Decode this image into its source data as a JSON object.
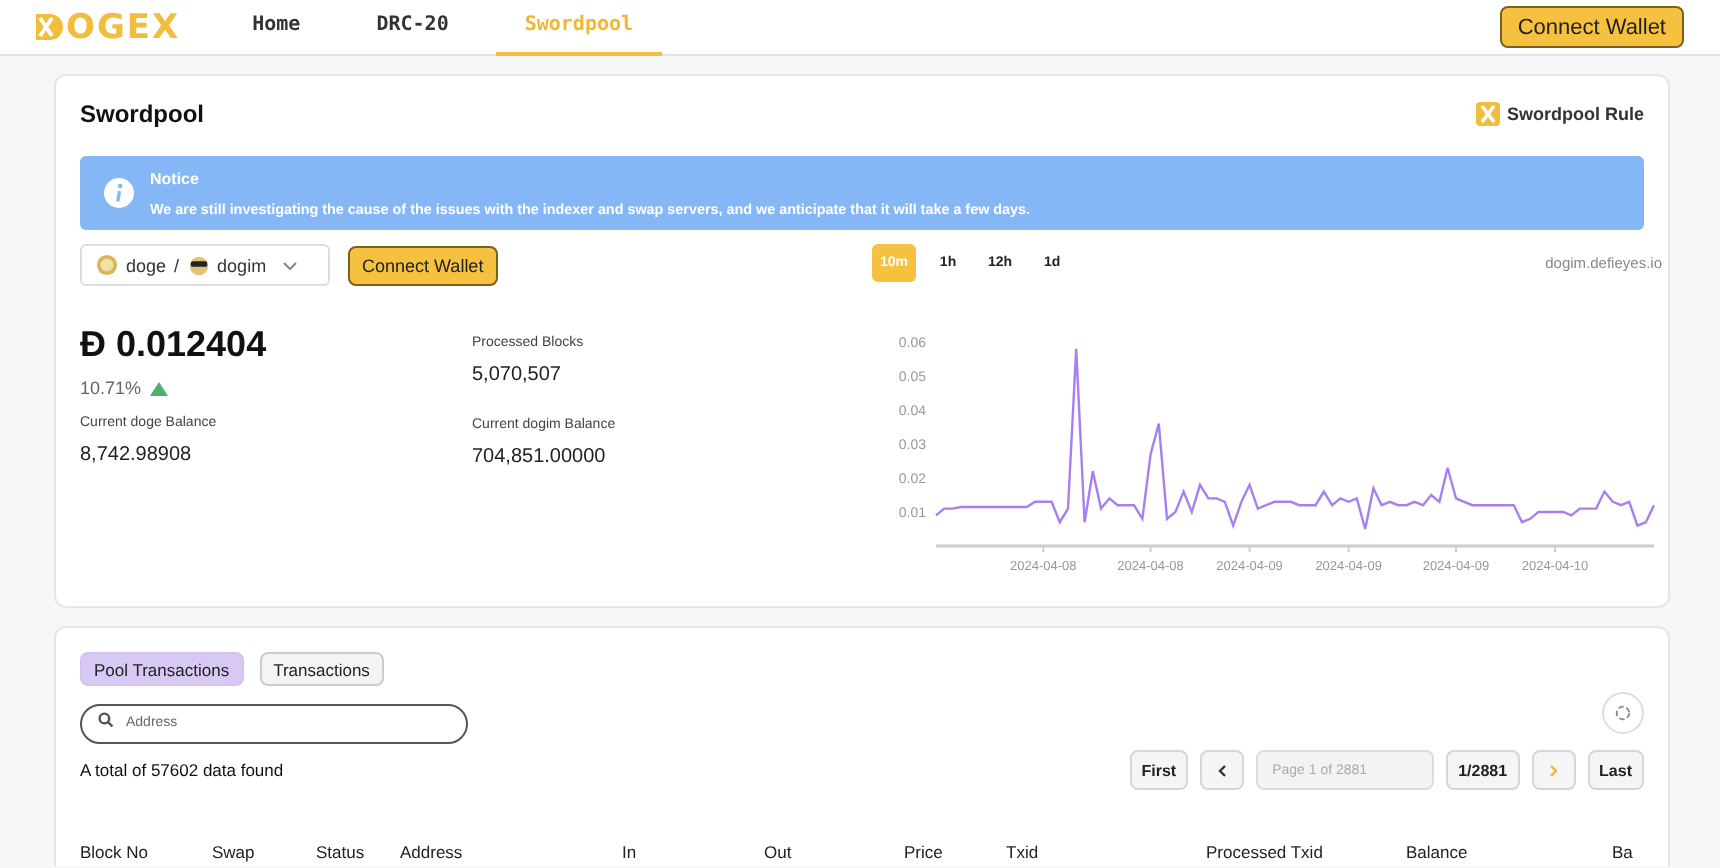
{
  "header": {
    "logo": "OGEX",
    "nav": [
      {
        "label": "Home",
        "selected": false
      },
      {
        "label": "DRC-20",
        "selected": false
      },
      {
        "label": "Swordpool",
        "selected": true
      }
    ],
    "connect_button": "Connect Wallet"
  },
  "pool_card": {
    "title": "Swordpool",
    "rule_link": "Swordpool Rule",
    "notice": {
      "title": "Notice",
      "message": "We are still investigating the cause of the issues with the indexer and swap servers, and we anticipate that it will take a few days."
    },
    "pair": {
      "base": "doge",
      "separator": "/",
      "quote": "dogim"
    },
    "connect_button": "Connect Wallet",
    "price": "Đ 0.012404",
    "change": "10.71%",
    "change_up": true,
    "stats": [
      {
        "label": "Processed Blocks",
        "value": "5,070,507"
      },
      {
        "label": "Current doge Balance",
        "value": "8,742.98908"
      },
      {
        "label": "Current dogim Balance",
        "value": "704,851.00000"
      }
    ],
    "timeframes": [
      {
        "label": "10m",
        "selected": true
      },
      {
        "label": "1h",
        "selected": false
      },
      {
        "label": "12h",
        "selected": false
      },
      {
        "label": "1d",
        "selected": false
      }
    ],
    "source": "dogim.defieyes.io",
    "chart_data": {
      "type": "line",
      "ylim": [
        0,
        0.06
      ],
      "yticks": [
        {
          "value": 0.01,
          "label": "0.01"
        },
        {
          "value": 0.02,
          "label": "0.02"
        },
        {
          "value": 0.03,
          "label": "0.03"
        },
        {
          "value": 0.04,
          "label": "0.04"
        },
        {
          "value": 0.05,
          "label": "0.05"
        },
        {
          "value": 0.06,
          "label": "0.06"
        }
      ],
      "categories": [
        null,
        null,
        null,
        null,
        null,
        null,
        null,
        null,
        null,
        null,
        null,
        null,
        null,
        "2024-04-08",
        null,
        null,
        null,
        null,
        null,
        null,
        null,
        null,
        null,
        null,
        null,
        null,
        "2024-04-08",
        null,
        null,
        null,
        null,
        null,
        null,
        null,
        null,
        null,
        null,
        null,
        "2024-04-09",
        null,
        null,
        null,
        null,
        null,
        null,
        null,
        null,
        null,
        null,
        null,
        "2024-04-09",
        null,
        null,
        null,
        null,
        null,
        null,
        null,
        null,
        null,
        null,
        null,
        null,
        "2024-04-09",
        null,
        null,
        null,
        null,
        null,
        null,
        null,
        null,
        null,
        null,
        null,
        "2024-04-10",
        null,
        null,
        null,
        null,
        null,
        null,
        null,
        null,
        null,
        null,
        null,
        null
      ],
      "series": [
        {
          "color": "#a97ff0",
          "values": [
            0.009,
            0.011,
            0.011,
            0.0115,
            0.0115,
            0.0115,
            0.0115,
            0.0115,
            0.0115,
            0.0115,
            0.0115,
            0.0115,
            0.013,
            0.013,
            0.013,
            0.007,
            0.011,
            0.058,
            0.007,
            0.022,
            0.011,
            0.014,
            0.012,
            0.012,
            0.012,
            0.008,
            0.027,
            0.036,
            0.008,
            0.01,
            0.016,
            0.01,
            0.018,
            0.014,
            0.014,
            0.013,
            0.006,
            0.013,
            0.018,
            0.011,
            0.012,
            0.013,
            0.013,
            0.013,
            0.012,
            0.012,
            0.012,
            0.016,
            0.012,
            0.014,
            0.013,
            0.014,
            0.005,
            0.017,
            0.012,
            0.013,
            0.012,
            0.012,
            0.013,
            0.012,
            0.015,
            0.013,
            0.023,
            0.014,
            0.013,
            0.012,
            0.012,
            0.012,
            0.012,
            0.012,
            0.012,
            0.007,
            0.008,
            0.01,
            0.01,
            0.01,
            0.01,
            0.009,
            0.011,
            0.011,
            0.011,
            0.016,
            0.013,
            0.012,
            0.013,
            0.006,
            0.007,
            0.012
          ]
        }
      ]
    }
  },
  "tx_card": {
    "tabs": [
      {
        "label": "Pool Transactions",
        "selected": true
      },
      {
        "label": "Transactions",
        "selected": false
      }
    ],
    "search": {
      "placeholder": "Address"
    },
    "total": "A total of 57602 data found",
    "pagination": {
      "first": "First",
      "page_placeholder": "Page 1 of 2881",
      "page_count": "1/2881",
      "last": "Last"
    },
    "columns": [
      "Block No",
      "Swap",
      "Status",
      "Address",
      "In",
      "Out",
      "Price",
      "Txid",
      "Processed Txid",
      "Balance",
      "Ba"
    ]
  }
}
